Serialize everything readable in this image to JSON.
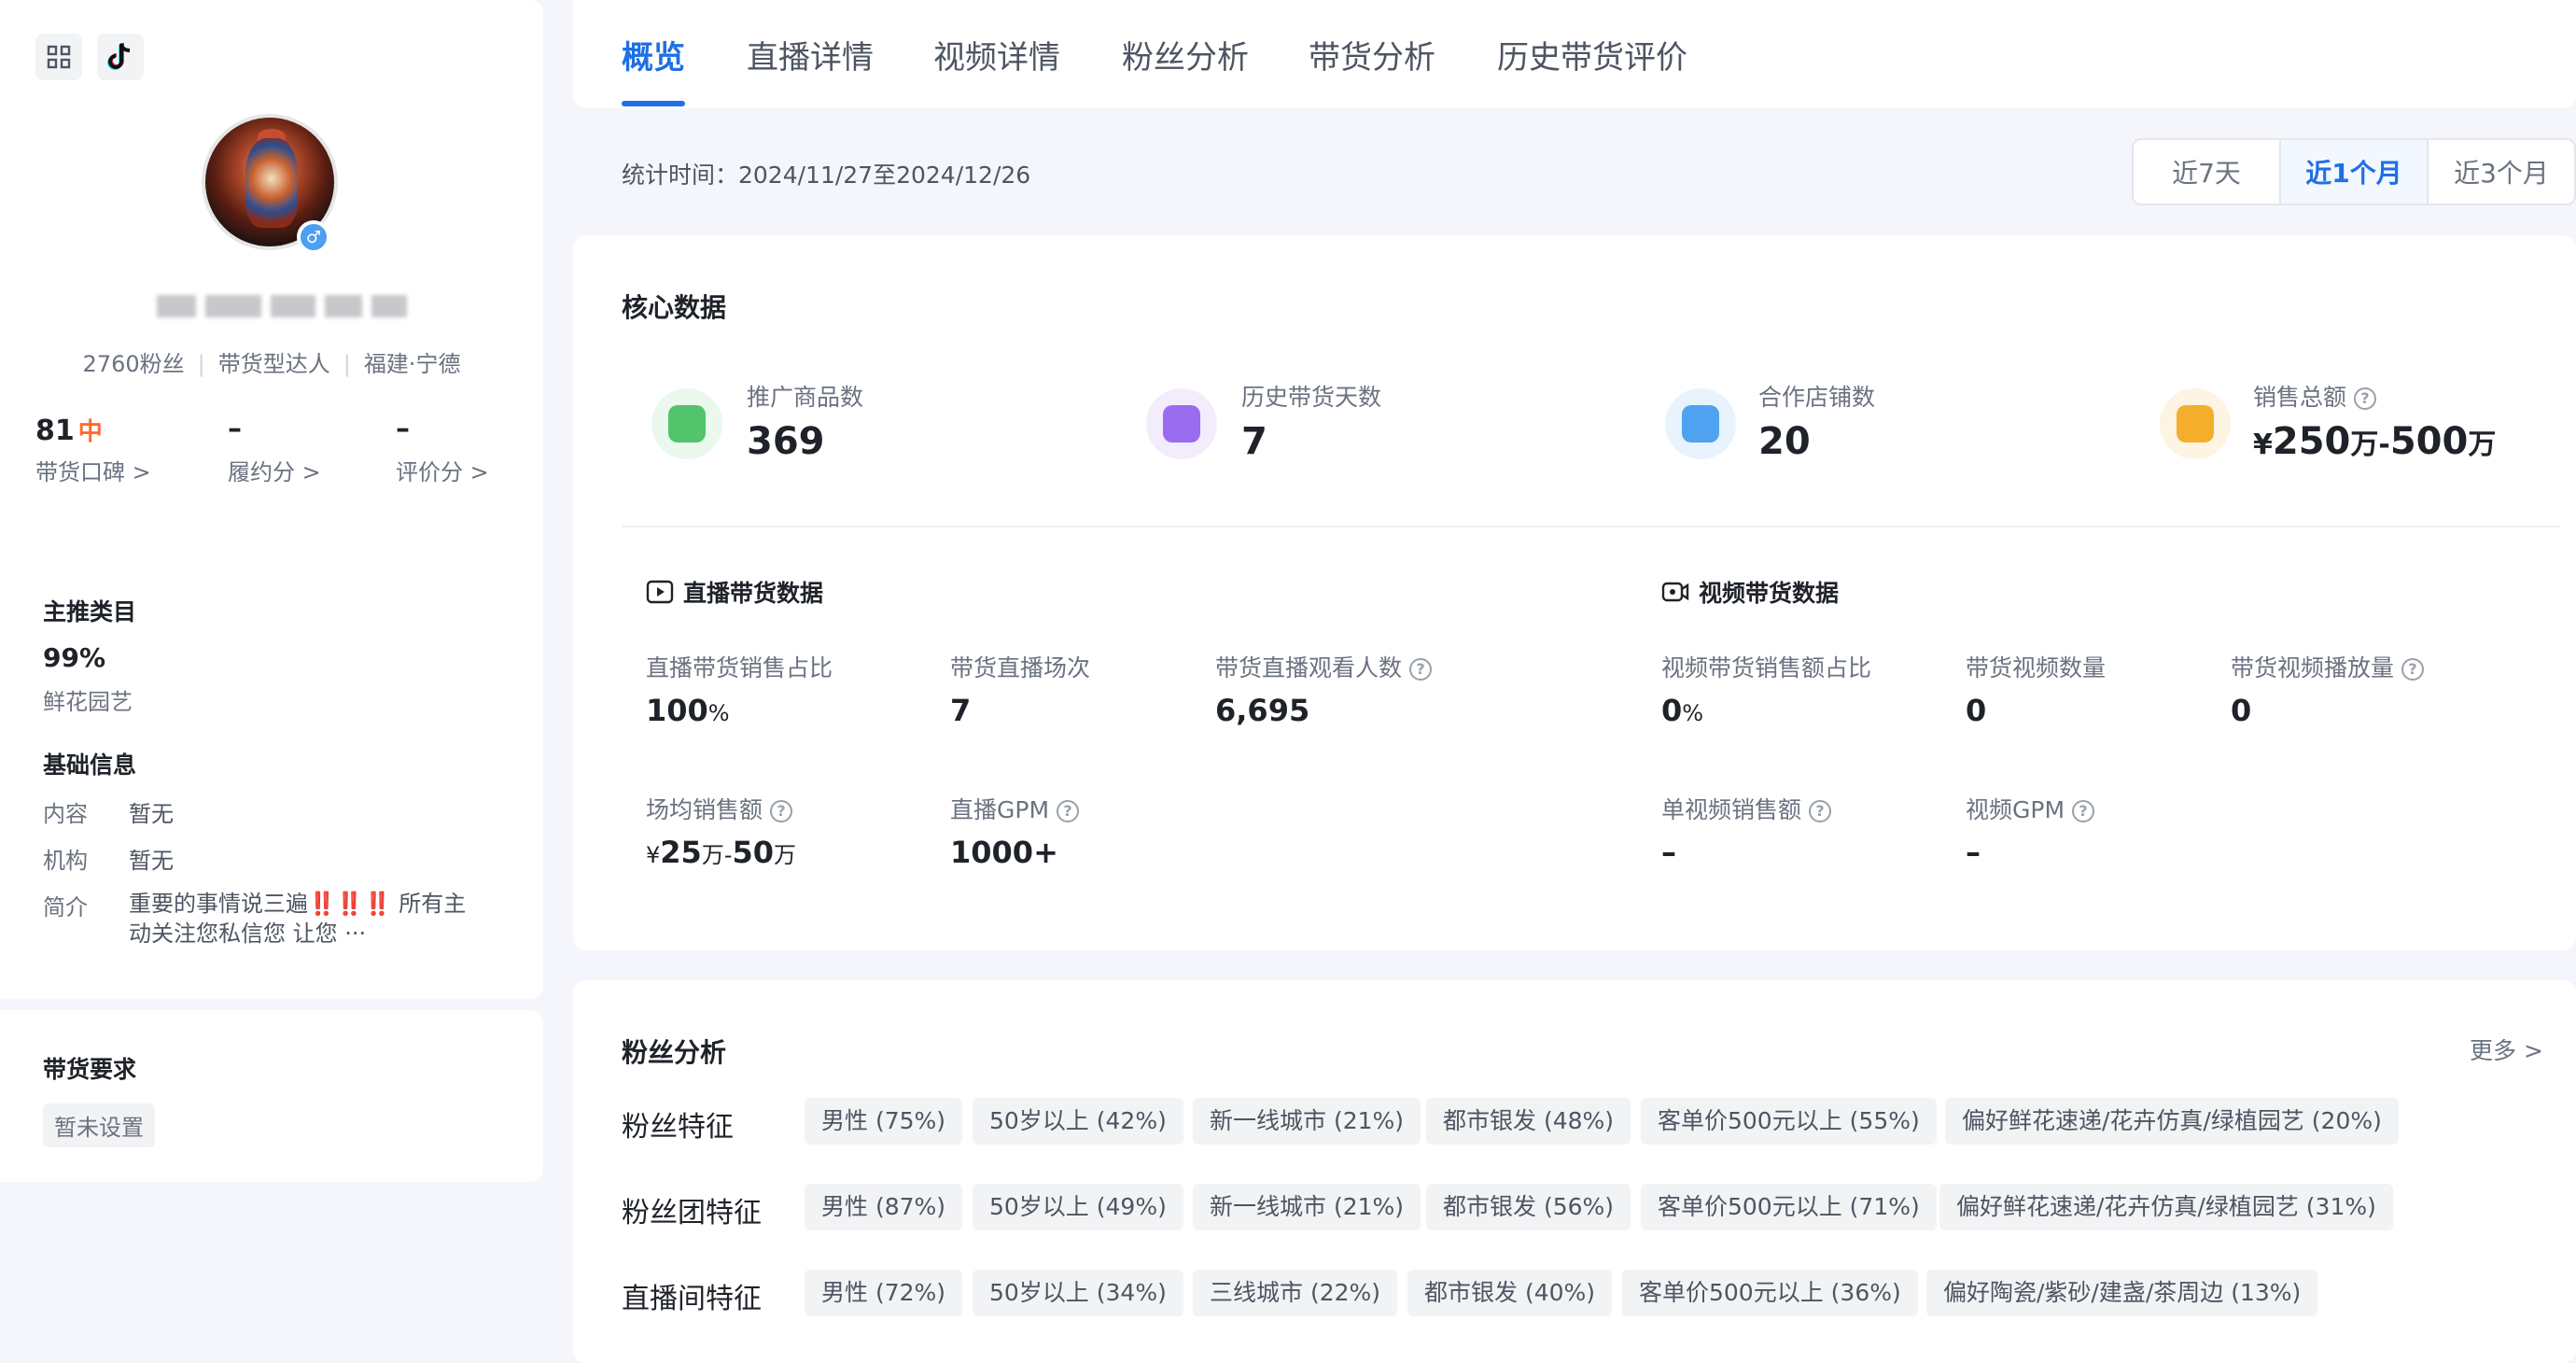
{
  "sidebar": {
    "followers": "2760粉丝",
    "type": "带货型达人",
    "location": "福建·宁德",
    "scores": [
      {
        "value": "81",
        "level": "中",
        "label": "带货口碑 >"
      },
      {
        "value": "–",
        "label": "履约分 >"
      },
      {
        "value": "–",
        "label": "评价分 >"
      }
    ],
    "main_category_title": "主推类目",
    "main_category_percent": "99%",
    "main_category_name": "鲜花园艺",
    "basic_info_title": "基础信息",
    "basic_info": [
      {
        "label": "内容",
        "value": "暂无"
      },
      {
        "label": "机构",
        "value": "暂无"
      },
      {
        "label": "简介",
        "value": "重要的事情说三遍‼️‼️‼️ 所有主动关注您私信您 让您 ···"
      }
    ],
    "requirement_title": "带货要求",
    "requirement_value": "暂未设置"
  },
  "tabs": [
    "概览",
    "直播详情",
    "视频详情",
    "粉丝分析",
    "带货分析",
    "历史带货评价"
  ],
  "stat_time": "统计时间：2024/11/27至2024/12/26",
  "ranges": [
    "近7天",
    "近1个月",
    "近3个月"
  ],
  "core": {
    "title": "核心数据",
    "metrics": [
      {
        "label": "推广商品数",
        "value": "369"
      },
      {
        "label": "历史带货天数",
        "value": "7"
      },
      {
        "label": "合作店铺数",
        "value": "20"
      },
      {
        "label": "销售总额",
        "value_prefix": "¥",
        "v1": "250",
        "u1": "万",
        "dash": "-",
        "v2": "500",
        "u2": "万"
      }
    ],
    "live": {
      "title": "直播带货数据",
      "items": [
        {
          "label": "直播带货销售占比",
          "value": "100",
          "unit": "%"
        },
        {
          "label": "带货直播场次",
          "value": "7"
        },
        {
          "label": "带货直播观看人数",
          "value": "6,695"
        },
        {
          "label": "场均销售额",
          "value_prefix": "¥",
          "v1": "25",
          "u1": "万",
          "dash": "-",
          "v2": "50",
          "u2": "万"
        },
        {
          "label": "直播GPM",
          "value": "1000+"
        }
      ]
    },
    "video": {
      "title": "视频带货数据",
      "items": [
        {
          "label": "视频带货销售额占比",
          "value": "0",
          "unit": "%"
        },
        {
          "label": "带货视频数量",
          "value": "0"
        },
        {
          "label": "带货视频播放量",
          "value": "0"
        },
        {
          "label": "单视频销售额",
          "value": "–"
        },
        {
          "label": "视频GPM",
          "value": "–"
        }
      ]
    }
  },
  "fans": {
    "title": "粉丝分析",
    "more": "更多 >",
    "rows": [
      {
        "label": "粉丝特征",
        "tags": [
          "男性 (75%)",
          "50岁以上 (42%)",
          "新一线城市 (21%)",
          "都市银发 (48%)",
          "客单价500元以上 (55%)",
          "偏好鲜花速递/花卉仿真/绿植园艺 (20%)"
        ]
      },
      {
        "label": "粉丝团特征",
        "tags": [
          "男性 (87%)",
          "50岁以上 (49%)",
          "新一线城市 (21%)",
          "都市银发 (56%)",
          "客单价500元以上 (71%)",
          "偏好鲜花速递/花卉仿真/绿植园艺 (31%)"
        ]
      },
      {
        "label": "直播间特征",
        "tags": [
          "男性 (72%)",
          "50岁以上 (34%)",
          "三线城市 (22%)",
          "都市银发 (40%)",
          "客单价500元以上 (36%)",
          "偏好陶瓷/紫砂/建盏/茶周边 (13%)"
        ]
      }
    ]
  }
}
